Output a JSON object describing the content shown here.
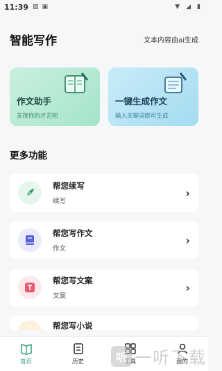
{
  "status": {
    "time": "11:39"
  },
  "header": {
    "title": "智能写作",
    "subtitle": "文本内容由ai生成"
  },
  "cards": [
    {
      "title": "作文助手",
      "subtitle": "发挥你的才艺吧",
      "theme": "green"
    },
    {
      "title": "一键生成作文",
      "subtitle": "输入关键词即可生成",
      "theme": "blue"
    }
  ],
  "more": {
    "title": "更多功能"
  },
  "features": [
    {
      "title": "帮您续写",
      "subtitle": "续写",
      "icon": "feather-icon",
      "icon_bg": "#e6f5ee",
      "icon_color": "#2f9a6f"
    },
    {
      "title": "帮您写作文",
      "subtitle": "作文",
      "icon": "book-icon",
      "icon_bg": "#e9ebfb",
      "icon_color": "#5b62d8"
    },
    {
      "title": "帮您写文案",
      "subtitle": "文案",
      "icon": "text-doc-icon",
      "icon_bg": "#fde9ec",
      "icon_color": "#e85a6f"
    },
    {
      "title": "帮您写小说",
      "subtitle": "",
      "icon": "novel-icon",
      "icon_bg": "#fdf1dd",
      "icon_color": "#e0a13a"
    }
  ],
  "nav": [
    {
      "label": "首页",
      "icon": "home-icon",
      "active": true
    },
    {
      "label": "历史",
      "icon": "history-icon",
      "active": false
    },
    {
      "label": "工具",
      "icon": "tools-icon",
      "active": false
    },
    {
      "label": "我的",
      "icon": "profile-icon",
      "active": false
    }
  ],
  "watermark": {
    "text": "一听下载"
  },
  "colors": {
    "accent": "#3aa57c",
    "background": "#f6f7f9"
  }
}
